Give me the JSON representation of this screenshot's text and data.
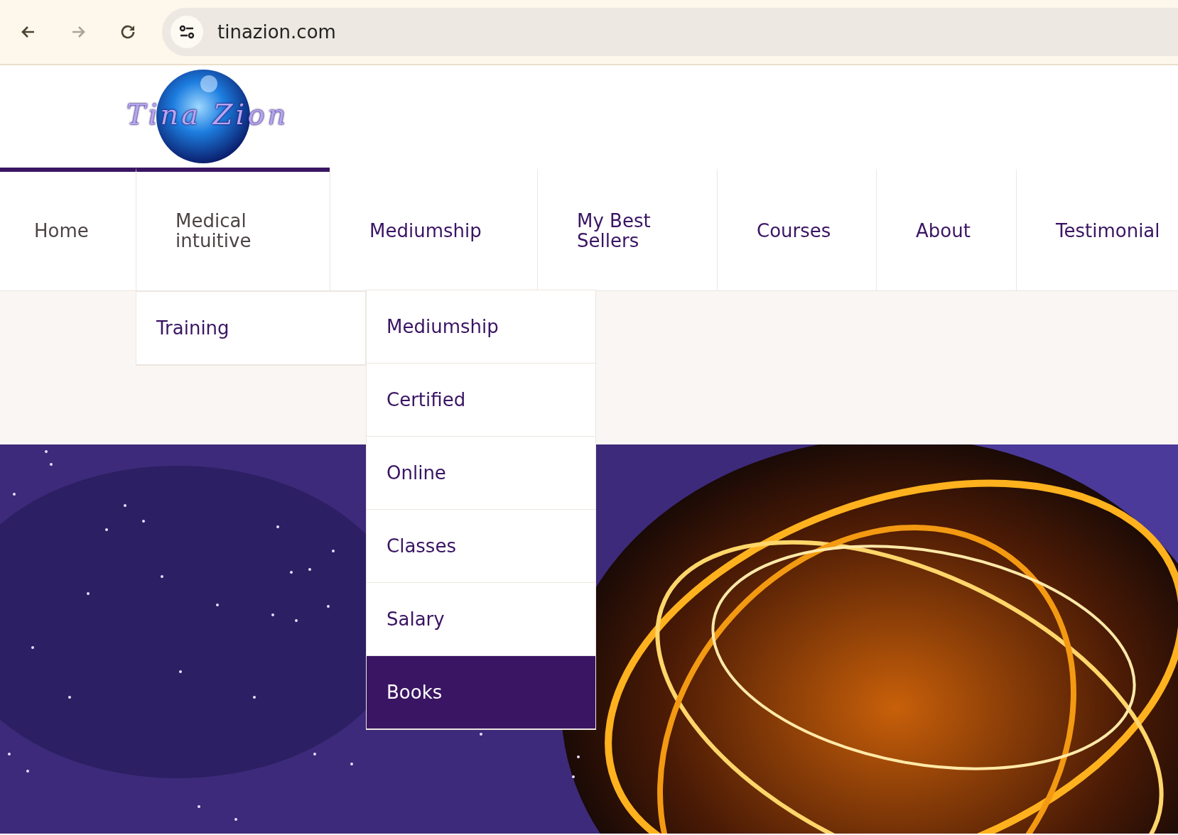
{
  "browser": {
    "nav_buttons": [
      {
        "kind": "back",
        "disabled": false
      },
      {
        "kind": "forward",
        "disabled": true
      },
      {
        "kind": "reload",
        "disabled": false
      }
    ],
    "url": "tinazion.com"
  },
  "logo": {
    "text": "Tina Zion"
  },
  "nav": {
    "items": [
      {
        "label": "Home",
        "highlighted": true
      },
      {
        "label": "Medical intuitive",
        "highlighted": true,
        "children": [
          {
            "label": "Training",
            "expanded": true,
            "children": [
              {
                "label": "Mediumship",
                "selected": false
              },
              {
                "label": "Certified",
                "selected": false
              },
              {
                "label": "Online",
                "selected": false
              },
              {
                "label": "Classes",
                "selected": false
              },
              {
                "label": "Salary",
                "selected": false
              },
              {
                "label": "Books",
                "selected": true
              }
            ]
          }
        ]
      },
      {
        "label": "Mediumship",
        "highlighted": false
      },
      {
        "label": "My Best Sellers",
        "highlighted": false
      },
      {
        "label": "Courses",
        "highlighted": false
      },
      {
        "label": "About",
        "highlighted": false
      },
      {
        "label": "Testimonial",
        "highlighted": false
      }
    ]
  }
}
